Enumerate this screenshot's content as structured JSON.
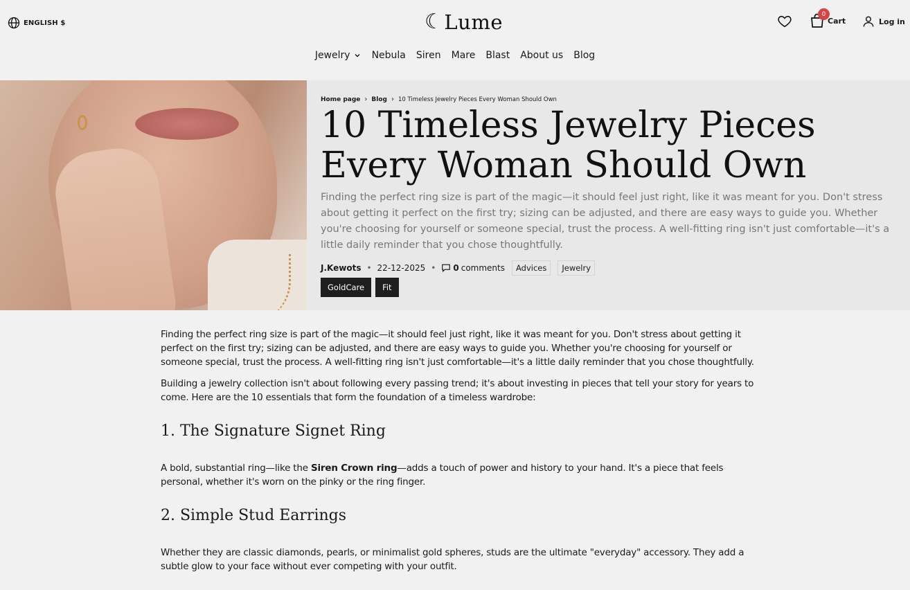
{
  "header": {
    "language": "ENGLISH $",
    "logo": "Lume",
    "cart_count": "0",
    "cart_label": "Cart",
    "login_label": "Log in"
  },
  "nav": {
    "items": [
      {
        "label": "Jewelry"
      },
      {
        "label": "Nebula"
      },
      {
        "label": "Siren"
      },
      {
        "label": "Mare"
      },
      {
        "label": "Blast"
      },
      {
        "label": "About us"
      },
      {
        "label": "Blog"
      }
    ]
  },
  "breadcrumb": {
    "home": "Home page",
    "blog": "Blog",
    "current": "10 Timeless Jewelry Pieces Every Woman Should Own"
  },
  "article": {
    "title": "10 Timeless Jewelry Pieces Every Woman Should Own",
    "lede": "Finding the perfect ring size is part of the magic—it should feel just right, like it was meant for you. Don't stress about getting it perfect on the first try; sizing can be adjusted, and there are easy ways to guide you. Whether you're choosing for yourself or someone special, trust the process. A well-fitting ring isn't just comfortable—it's a little daily reminder that you chose thoughtfully.",
    "author": "J.Kewots",
    "date": "22-12-2025",
    "comments_count": "0",
    "comments_label": "comments",
    "tags": [
      "Advices",
      "Jewelry"
    ],
    "tags_dark": [
      "GoldCare",
      "Fit"
    ],
    "body": {
      "p1": "Finding the perfect ring size is part of the magic—it should feel just right, like it was meant for you. Don't stress about getting it perfect on the first try; sizing can be adjusted, and there are easy ways to guide you. Whether you're choosing for yourself or someone special, trust the process. A well-fitting ring isn't just comfortable—it's a little daily reminder that you chose thoughtfully.",
      "p2": "Building a jewelry collection isn't about following every passing trend; it's about investing in pieces that tell your story for years to come. Here are the 10 essentials that form the foundation of a timeless wardrobe:",
      "h1": "1. The Signature Signet Ring",
      "p3_before": "A bold, substantial ring—like the ",
      "p3_strong": "Siren Crown ring",
      "p3_after": "—adds a touch of power and history to your hand. It's a piece that feels personal, whether it's worn on the pinky or the ring finger.",
      "h2": "2. Simple Stud Earrings",
      "p4": "Whether they are classic diamonds, pearls, or minimalist gold spheres, studs are the ultimate \"everyday\" accessory. They add a subtle glow to your face without ever competing with your outfit."
    }
  },
  "colors": {
    "background": "#f1f1f1",
    "hero_panel": "#e8e8e8",
    "badge": "#d64545",
    "dark_tag": "#1e1e1e"
  }
}
